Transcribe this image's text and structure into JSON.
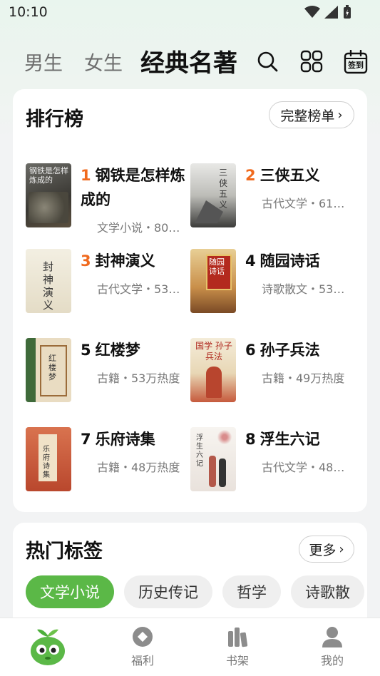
{
  "status": {
    "time": "10:10"
  },
  "nav": {
    "tabs": [
      {
        "label": "男生"
      },
      {
        "label": "女生"
      },
      {
        "label": "经典名著"
      }
    ],
    "checkin_label": "签到"
  },
  "ranking": {
    "title": "排行榜",
    "full_list": "完整榜单",
    "books": [
      {
        "rank": "1",
        "title": "钢铁是怎样炼成的",
        "meta": "文学小说・80…",
        "cover_text": "钢铁是怎样炼成的"
      },
      {
        "rank": "2",
        "title": "三侠五义",
        "meta": "古代文学・61…",
        "cover_text": "三侠五义"
      },
      {
        "rank": "3",
        "title": "封神演义",
        "meta": "古代文学・53…",
        "cover_text": "封神演义"
      },
      {
        "rank": "4",
        "title": "随园诗话",
        "meta": "诗歌散文・53…",
        "cover_text": "随园诗话"
      },
      {
        "rank": "5",
        "title": "红楼梦",
        "meta": "古籍・53万热度",
        "cover_text": "红楼梦"
      },
      {
        "rank": "6",
        "title": "孙子兵法",
        "meta": "古籍・49万热度",
        "cover_text": "国学 孙子兵法"
      },
      {
        "rank": "7",
        "title": "乐府诗集",
        "meta": "古籍・48万热度",
        "cover_text": "乐府诗集"
      },
      {
        "rank": "8",
        "title": "浮生六记",
        "meta": "古代文学・48…",
        "cover_text": "浮生六记"
      }
    ]
  },
  "hot_tags": {
    "title": "热门标签",
    "more": "更多",
    "tags": [
      "文学小说",
      "历史传记",
      "哲学",
      "诗歌散"
    ]
  },
  "bottom_nav": {
    "items": [
      {
        "label": ""
      },
      {
        "label": "福利"
      },
      {
        "label": "书架"
      },
      {
        "label": "我的"
      }
    ]
  },
  "colors": {
    "accent": "#5bb847",
    "hot_rank": "#f06a1e"
  }
}
